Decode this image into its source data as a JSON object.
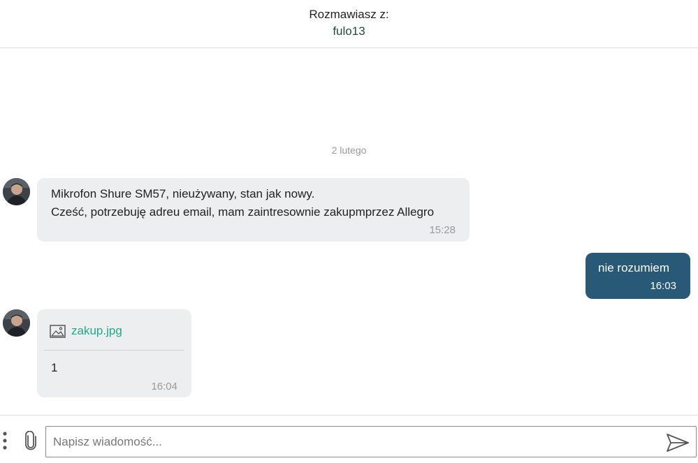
{
  "header": {
    "label": "Rozmawiasz z:",
    "username": "fulo13"
  },
  "conversation": {
    "date_separator": "2 lutego",
    "messages": [
      {
        "direction": "incoming",
        "lines": [
          "Mikrofon Shure SM57, nieużywany, stan jak nowy.",
          "Cześć, potrzebuję adreu email, mam zaintresownie zakupmprzez Allegro"
        ],
        "time": "15:28"
      },
      {
        "direction": "outgoing",
        "text": "nie rozumiem",
        "time": "16:03"
      },
      {
        "direction": "incoming",
        "attachment": {
          "icon": "image-icon",
          "filename": "zakup.jpg"
        },
        "text": "1",
        "time": "16:04"
      }
    ]
  },
  "composer": {
    "placeholder": "Napisz wiadomość...",
    "value": "",
    "more_icon": "vertical-dots-icon",
    "attach_icon": "paperclip-icon",
    "send_icon": "send-icon"
  },
  "colors": {
    "incoming_bubble": "#eceef0",
    "outgoing_bubble": "#285a78",
    "username": "#1f4d3a",
    "attachment_link": "#1faa8a"
  }
}
